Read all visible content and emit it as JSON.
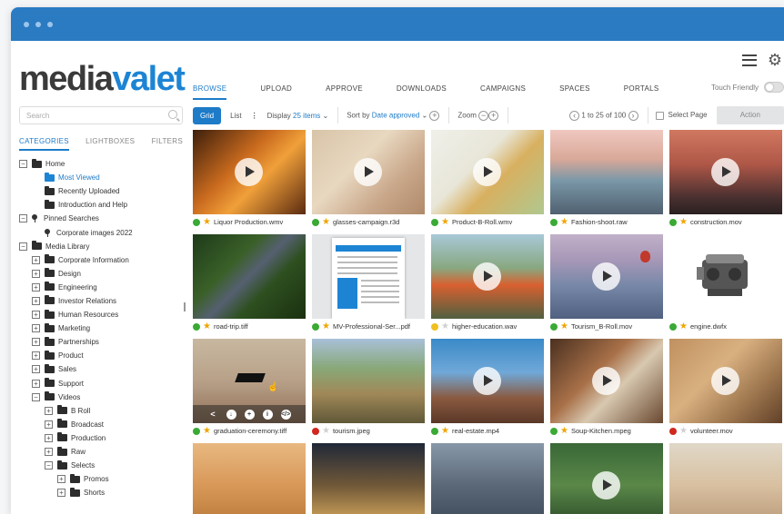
{
  "app": {
    "logo_part1": "media",
    "logo_part2": "valet"
  },
  "nav": {
    "items": [
      "BROWSE",
      "UPLOAD",
      "APPROVE",
      "DOWNLOADS",
      "CAMPAIGNS",
      "SPACES",
      "PORTALS"
    ],
    "active": "BROWSE",
    "touch_friendly_label": "Touch Friendly",
    "touch_friendly_on": false
  },
  "sidebar": {
    "search_placeholder": "Search",
    "tabs": [
      "CATEGORIES",
      "LIGHTBOXES",
      "FILTERS"
    ],
    "active_tab": "CATEGORIES",
    "tree": [
      {
        "label": "Home",
        "level": 0,
        "expander": "−",
        "icon": "folder"
      },
      {
        "label": "Most Viewed",
        "level": 1,
        "expander": "",
        "icon": "folder-open",
        "active": true
      },
      {
        "label": "Recently Uploaded",
        "level": 1,
        "expander": "",
        "icon": "folder"
      },
      {
        "label": "Introduction and Help",
        "level": 1,
        "expander": "",
        "icon": "folder"
      },
      {
        "label": "Pinned Searches",
        "level": 0,
        "expander": "−",
        "icon": "pin"
      },
      {
        "label": "Corporate images 2022",
        "level": 1,
        "expander": "",
        "icon": "pin"
      },
      {
        "label": "Media Library",
        "level": 0,
        "expander": "−",
        "icon": "folder"
      },
      {
        "label": "Corporate Information",
        "level": 1,
        "expander": "+",
        "icon": "folder"
      },
      {
        "label": "Design",
        "level": 1,
        "expander": "+",
        "icon": "folder"
      },
      {
        "label": "Engineering",
        "level": 1,
        "expander": "+",
        "icon": "folder"
      },
      {
        "label": "Investor Relations",
        "level": 1,
        "expander": "+",
        "icon": "folder"
      },
      {
        "label": "Human Resources",
        "level": 1,
        "expander": "+",
        "icon": "folder"
      },
      {
        "label": "Marketing",
        "level": 1,
        "expander": "+",
        "icon": "folder"
      },
      {
        "label": "Partnerships",
        "level": 1,
        "expander": "+",
        "icon": "folder"
      },
      {
        "label": "Product",
        "level": 1,
        "expander": "+",
        "icon": "folder"
      },
      {
        "label": "Sales",
        "level": 1,
        "expander": "+",
        "icon": "folder"
      },
      {
        "label": "Support",
        "level": 1,
        "expander": "+",
        "icon": "folder"
      },
      {
        "label": "Videos",
        "level": 1,
        "expander": "−",
        "icon": "folder"
      },
      {
        "label": "B Roll",
        "level": 2,
        "expander": "+",
        "icon": "folder"
      },
      {
        "label": "Broadcast",
        "level": 2,
        "expander": "+",
        "icon": "folder"
      },
      {
        "label": "Production",
        "level": 2,
        "expander": "+",
        "icon": "folder"
      },
      {
        "label": "Raw",
        "level": 2,
        "expander": "+",
        "icon": "folder"
      },
      {
        "label": "Selects",
        "level": 2,
        "expander": "−",
        "icon": "folder"
      },
      {
        "label": "Promos",
        "level": 3,
        "expander": "+",
        "icon": "folder"
      },
      {
        "label": "Shorts",
        "level": 3,
        "expander": "+",
        "icon": "folder"
      }
    ]
  },
  "toolbar": {
    "grid_label": "Grid",
    "list_label": "List",
    "more_label": "⋮",
    "display_label": "Display",
    "display_value": "25 items",
    "sort_label": "Sort by",
    "sort_value": "Date approved",
    "zoom_label": "Zoom",
    "pagination": "1 to 25 of 100",
    "select_page_label": "Select Page",
    "action_label": "Action"
  },
  "assets": [
    {
      "name": "Liquor Production.wmv",
      "status": "green",
      "starred": true,
      "video": true,
      "thumb": "linear-gradient(135deg,#3d1f0c 0%,#c96a1e 40%,#f0a03a 60%,#5a2a10 100%)"
    },
    {
      "name": "glasses-campaign.r3d",
      "status": "green",
      "starred": true,
      "video": true,
      "thumb": "linear-gradient(135deg,#d8c4a8 0%,#e8d8c0 40%,#c9a78a 70%,#b08a6a 100%)"
    },
    {
      "name": "Product-B-Roll.wmv",
      "status": "green",
      "starred": true,
      "video": true,
      "thumb": "linear-gradient(135deg,#f0f0ea 0%,#e8e6d8 40%,#d8b060 60%,#b0c890 100%)"
    },
    {
      "name": "Fashion-shoot.raw",
      "status": "green",
      "starred": true,
      "video": false,
      "thumb": "linear-gradient(180deg,#f0c8c0 0%,#d8a898 35%,#7a98a8 60%,#506070 100%)"
    },
    {
      "name": "construction.mov",
      "status": "green",
      "starred": true,
      "video": true,
      "thumb": "linear-gradient(180deg,#d07860 0%,#b05848 40%,#4a3030 80%,#2a2020 100%)"
    },
    {
      "name": "road-trip.tiff",
      "status": "green",
      "starred": true,
      "video": false,
      "thumb": "linear-gradient(135deg,#1e3a1a 0%,#3a6028 35%,#556070 50%,#2e5020 65%,#1a3010 100%)"
    },
    {
      "name": "MV-Professional-Ser...pdf",
      "status": "green",
      "starred": true,
      "video": false,
      "thumb": "#e4e6e8",
      "pdf": true
    },
    {
      "name": "higher-education.wav",
      "status": "yellow",
      "starred": false,
      "video": true,
      "thumb": "linear-gradient(180deg,#a8c8d8 0%,#88a880 40%,#d86030 60%,#506040 100%)"
    },
    {
      "name": "Tourism_B-Roll.mov",
      "status": "green",
      "starred": true,
      "video": true,
      "thumb": "linear-gradient(180deg,#c0b0c8 0%,#a898b8 30%,#7888a8 60%,#506080 100%)",
      "balloon": true
    },
    {
      "name": "engine.dwfx",
      "status": "green",
      "starred": true,
      "video": false,
      "thumb": "#ffffff",
      "engine": true
    },
    {
      "name": "graduation-ceremony.tiff",
      "status": "green",
      "starred": true,
      "video": false,
      "thumb": "linear-gradient(180deg,#c8b8a0 0%,#b8a088 50%,#907058 100%)",
      "hover": true
    },
    {
      "name": "tourism.jpeg",
      "status": "red",
      "starred": false,
      "video": false,
      "thumb": "linear-gradient(180deg,#a8c0d8 0%,#88a878 35%,#a08858 65%,#605838 100%)"
    },
    {
      "name": "real-estate.mp4",
      "status": "green",
      "starred": true,
      "video": true,
      "thumb": "linear-gradient(180deg,#3a8ac8 0%,#70a8d8 40%,#8a5a40 70%,#5a3828 100%)"
    },
    {
      "name": "Soup-Kitchen.mpeg",
      "status": "green",
      "starred": true,
      "video": true,
      "thumb": "linear-gradient(135deg,#4a3020 0%,#a87048 40%,#d8c8b0 60%,#6a4830 100%)"
    },
    {
      "name": "volunteer.mov",
      "status": "red",
      "starred": false,
      "video": true,
      "thumb": "linear-gradient(135deg,#c09060 0%,#d8b080 40%,#a07850 70%,#604028 100%)"
    },
    {
      "name": "",
      "status": "",
      "starred": false,
      "video": false,
      "thumb": "linear-gradient(180deg,#e8b880 0%,#d89858 50%,#b87838 100%)"
    },
    {
      "name": "",
      "status": "",
      "starred": false,
      "video": false,
      "thumb": "linear-gradient(180deg,#202838 0%,#705838 50%,#e0b060 100%)"
    },
    {
      "name": "",
      "status": "",
      "starred": false,
      "video": false,
      "thumb": "linear-gradient(180deg,#8898a8 0%,#5a6878 50%,#3a4858 100%)"
    },
    {
      "name": "",
      "status": "",
      "starred": false,
      "video": true,
      "thumb": "linear-gradient(180deg,#3a6838 0%,#5a8848 50%,#2a4828 100%)"
    },
    {
      "name": "",
      "status": "",
      "starred": false,
      "video": false,
      "thumb": "linear-gradient(180deg,#e0d8c8 0%,#d8c0a0 50%,#b89878 100%)"
    }
  ],
  "hover_actions": [
    "share",
    "download",
    "add",
    "info",
    "embed"
  ],
  "colors": {
    "accent": "#1d7bc8",
    "titlebar": "#2a7bc2",
    "status_green": "#3aaa35",
    "status_yellow": "#f0c020",
    "status_red": "#d0281e",
    "star_gold": "#f0a500",
    "star_grey": "#d0d0d0"
  }
}
